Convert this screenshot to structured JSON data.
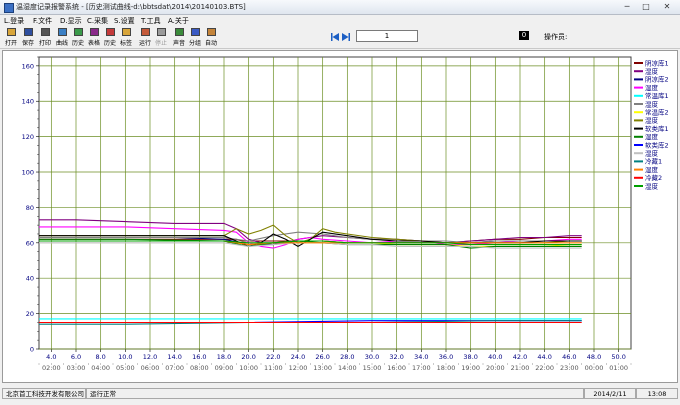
{
  "window": {
    "title": "温湿度记录报警系统 - [历史测试曲线-d:\\bbtsdat\\2014\\20140103.BTS]",
    "minimize": "─",
    "maximize": "□",
    "close": "✕"
  },
  "menu": [
    "L.登录",
    "F.文件",
    "D.显示",
    "C.采集",
    "S.设置",
    "T.工具",
    "A.关于"
  ],
  "toolbar": [
    {
      "label": "打开",
      "icon": "folder-open-icon",
      "color": "#d8a53a",
      "enabled": true
    },
    {
      "label": "保存",
      "icon": "save-icon",
      "color": "#2f4f9f",
      "enabled": true
    },
    {
      "label": "打印",
      "icon": "printer-icon",
      "color": "#555555",
      "enabled": true
    },
    {
      "label": "曲线",
      "icon": "curve-icon",
      "color": "#3a7fc4",
      "enabled": true
    },
    {
      "label": "历史",
      "icon": "history-icon",
      "color": "#3a9a4a",
      "enabled": true
    },
    {
      "label": "表格",
      "icon": "table-icon",
      "color": "#8a2a8a",
      "enabled": true
    },
    {
      "label": "历史",
      "icon": "history-table-icon",
      "color": "#c43a3a",
      "enabled": true
    },
    {
      "label": "标签",
      "icon": "tag-icon",
      "color": "#d8a53a",
      "enabled": true
    },
    {
      "label": "运行",
      "icon": "run-icon",
      "color": "#c45a3a",
      "enabled": true
    },
    {
      "label": "停止",
      "icon": "stop-icon",
      "color": "#9a9a9a",
      "enabled": false
    },
    {
      "label": "声音",
      "icon": "sound-icon",
      "color": "#3a8a3a",
      "enabled": true
    },
    {
      "label": "分组",
      "icon": "group-icon",
      "color": "#3a5ac4",
      "enabled": true
    },
    {
      "label": "自动",
      "icon": "auto-icon",
      "color": "#c4843a",
      "enabled": true
    }
  ],
  "navigation": {
    "page": "1",
    "count": "0",
    "operator_label": "操作员:"
  },
  "status": {
    "company": "北京首工科技开发有限公司",
    "state": "运行正常",
    "date": "2014/2/11",
    "time": "13:08"
  },
  "chart_data": {
    "type": "line",
    "ylim": [
      0,
      165
    ],
    "yticks": [
      0,
      20,
      40,
      60,
      80,
      100,
      120,
      140,
      160
    ],
    "xlim": [
      3.0,
      51.0
    ],
    "xticks": [
      "4.0",
      "6.0",
      "8.0",
      "10.0",
      "12.0",
      "14.0",
      "16.0",
      "18.0",
      "20.0",
      "22.0",
      "24.0",
      "26.0",
      "28.0",
      "30.0",
      "32.0",
      "34.0",
      "36.0",
      "38.0",
      "40.0",
      "42.0",
      "44.0",
      "46.0",
      "48.0",
      "50.0"
    ],
    "time_ticks": [
      "02:00",
      "03:00",
      "04:00",
      "05:00",
      "06:00",
      "07:00",
      "08:00",
      "09:00",
      "10:00",
      "11:00",
      "12:00",
      "13:00",
      "14:00",
      "15:00",
      "16:00",
      "17:00",
      "18:00",
      "19:00",
      "20:00",
      "21:00",
      "22:00",
      "23:00",
      "00:00",
      "01:00"
    ],
    "grid": true,
    "legend_position": "right",
    "series": [
      {
        "name": "阴凉库1",
        "color": "#800000",
        "x": [
          3,
          19,
          19.5,
          20,
          21,
          22,
          24,
          26,
          28,
          30,
          32,
          34,
          36,
          38,
          40,
          42,
          44,
          46,
          47
        ],
        "y": [
          62,
          62,
          61,
          61,
          61,
          61,
          61,
          61,
          60,
          60,
          60,
          60,
          60,
          61,
          62,
          62,
          63,
          63,
          63
        ]
      },
      {
        "name": "湿度",
        "color": "#800080",
        "x": [
          3,
          6,
          10,
          14,
          18,
          19,
          20,
          21,
          22,
          23,
          24,
          26,
          28,
          30,
          32,
          34,
          36,
          38,
          40,
          42,
          44,
          46,
          47
        ],
        "y": [
          73,
          73,
          72,
          71,
          71,
          68,
          62,
          60,
          59,
          60,
          62,
          64,
          63,
          62,
          62,
          61,
          60,
          61,
          62,
          63,
          63,
          64,
          64
        ]
      },
      {
        "name": "阴凉库2",
        "color": "#000080",
        "x": [
          3,
          10,
          14,
          18,
          20,
          22,
          24,
          26,
          28,
          30,
          32,
          34,
          36,
          38,
          40,
          42,
          44,
          46,
          47
        ],
        "y": [
          63,
          63,
          63,
          62,
          59,
          59,
          61,
          61,
          60,
          60,
          60,
          60,
          60,
          60,
          61,
          61,
          61,
          61,
          61
        ]
      },
      {
        "name": "湿度",
        "color": "#ff00ff",
        "x": [
          3,
          10,
          14,
          18,
          19,
          20,
          21,
          22,
          23,
          24,
          25,
          26,
          28,
          30,
          32,
          34,
          36,
          38,
          40,
          42,
          44,
          46,
          47
        ],
        "y": [
          69,
          69,
          68,
          67,
          66,
          60,
          58,
          57,
          59,
          62,
          63,
          62,
          61,
          60,
          61,
          61,
          59,
          59,
          60,
          61,
          61,
          62,
          62
        ]
      },
      {
        "name": "常温库1",
        "color": "#00ffff",
        "x": [
          3,
          10,
          20,
          30,
          40,
          47
        ],
        "y": [
          17,
          17,
          17,
          17,
          17,
          17
        ]
      },
      {
        "name": "湿度",
        "color": "#808080",
        "x": [
          3,
          12,
          18,
          20,
          22,
          24,
          26,
          28,
          30,
          32,
          34,
          36,
          38,
          40,
          42,
          44,
          46,
          47
        ],
        "y": [
          63,
          63,
          63,
          61,
          64,
          66,
          65,
          63,
          62,
          62,
          61,
          61,
          60,
          61,
          61,
          61,
          61,
          61
        ]
      },
      {
        "name": "常温库2",
        "color": "#ffff00",
        "x": [
          3,
          10,
          18,
          20,
          22,
          24,
          26,
          28,
          30,
          32,
          34,
          36,
          38,
          40,
          42,
          44,
          46,
          47
        ],
        "y": [
          61,
          61,
          61,
          59,
          60,
          61,
          61,
          60,
          60,
          59,
          59,
          59,
          58,
          58,
          58,
          58,
          59,
          59
        ]
      },
      {
        "name": "湿度",
        "color": "#808000",
        "x": [
          3,
          10,
          18,
          19,
          20,
          21,
          22,
          23,
          24,
          25,
          26,
          27,
          28,
          30,
          32,
          34,
          36,
          38,
          40,
          42,
          44,
          46,
          47
        ],
        "y": [
          64,
          64,
          64,
          68,
          65,
          67,
          70,
          64,
          60,
          62,
          68,
          66,
          65,
          63,
          62,
          61,
          60,
          60,
          60,
          60,
          60,
          61,
          61
        ]
      },
      {
        "name": "软类库1",
        "color": "#000000",
        "x": [
          3,
          12,
          18,
          20,
          21,
          22,
          23,
          24,
          25,
          26,
          28,
          30,
          32,
          34,
          36,
          38,
          40,
          42,
          44,
          46,
          47
        ],
        "y": [
          64,
          64,
          64,
          58,
          60,
          65,
          62,
          58,
          62,
          66,
          64,
          62,
          61,
          61,
          60,
          60,
          60,
          60,
          61,
          61,
          61
        ]
      },
      {
        "name": "湿度",
        "color": "#008000",
        "x": [
          3,
          10,
          18,
          20,
          22,
          24,
          26,
          28,
          30,
          32,
          34,
          36,
          38,
          40,
          42,
          44,
          46,
          47
        ],
        "y": [
          62,
          62,
          61,
          58,
          60,
          61,
          60,
          59,
          59,
          59,
          59,
          59,
          57,
          58,
          58,
          58,
          58,
          58
        ]
      },
      {
        "name": "软类库2",
        "color": "#0000ff",
        "x": [
          3,
          10,
          20,
          30,
          40,
          47
        ],
        "y": [
          15,
          15,
          15,
          16,
          16,
          16
        ]
      },
      {
        "name": "湿度",
        "color": "#c0c0c0",
        "x": [
          3,
          10,
          18,
          20,
          22,
          24,
          26,
          28,
          30,
          32,
          34,
          36,
          38,
          40,
          42,
          44,
          46,
          47
        ],
        "y": [
          60,
          60,
          60,
          58,
          59,
          60,
          60,
          59,
          59,
          58,
          58,
          58,
          58,
          57,
          57,
          57,
          57,
          57
        ]
      },
      {
        "name": "冷藏1",
        "color": "#008080",
        "x": [
          3,
          10,
          20,
          30,
          40,
          47
        ],
        "y": [
          14,
          14,
          15,
          15,
          16,
          16
        ]
      },
      {
        "name": "湿度",
        "color": "#ff8000",
        "x": [
          3,
          10,
          18,
          20,
          22,
          24,
          26,
          28,
          30,
          32,
          34,
          36,
          38,
          40,
          42,
          44,
          46,
          47
        ],
        "y": [
          61,
          61,
          61,
          59,
          60,
          60,
          60,
          60,
          60,
          60,
          60,
          60,
          60,
          60,
          60,
          60,
          60,
          60
        ]
      },
      {
        "name": "冷藏2",
        "color": "#ff0000",
        "x": [
          3,
          10,
          20,
          30,
          40,
          47
        ],
        "y": [
          15,
          15,
          15,
          15,
          15,
          15
        ]
      },
      {
        "name": "湿度",
        "color": "#00a000",
        "x": [
          3,
          10,
          18,
          20,
          22,
          24,
          26,
          28,
          30,
          32,
          34,
          36,
          38,
          40,
          42,
          44,
          46,
          47
        ],
        "y": [
          61,
          61,
          61,
          60,
          60,
          61,
          61,
          60,
          60,
          60,
          60,
          60,
          59,
          59,
          59,
          59,
          59,
          59
        ]
      }
    ]
  }
}
